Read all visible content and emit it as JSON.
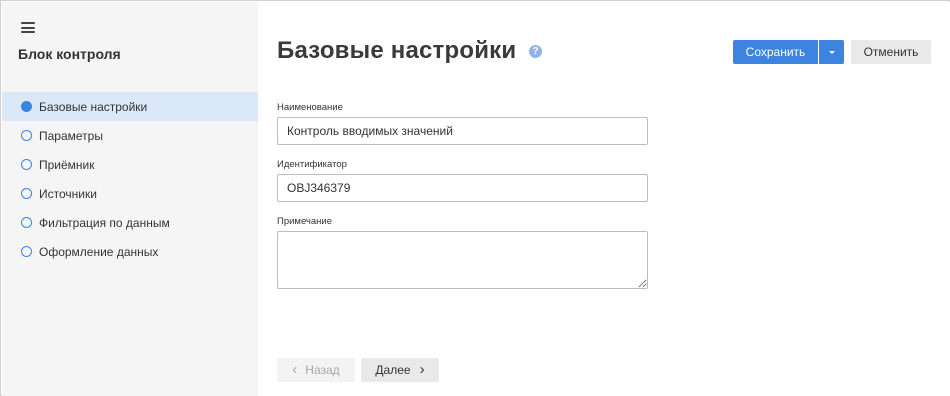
{
  "sidebar": {
    "menu_icon": "hamburger-menu-icon",
    "title": "Блок контроля",
    "items": [
      {
        "label": "Базовые настройки",
        "active": true
      },
      {
        "label": "Параметры",
        "active": false
      },
      {
        "label": "Приёмник",
        "active": false
      },
      {
        "label": "Источники",
        "active": false
      },
      {
        "label": "Фильтрация по данным",
        "active": false
      },
      {
        "label": "Оформление данных",
        "active": false
      }
    ]
  },
  "main": {
    "title": "Базовые настройки",
    "help_icon": "?",
    "save_label": "Сохранить",
    "cancel_label": "Отменить",
    "fields": {
      "name": {
        "label": "Наименование",
        "value": "Контроль вводимых значений"
      },
      "identifier": {
        "label": "Идентификатор",
        "value": "OBJ346379"
      },
      "note": {
        "label": "Примечание",
        "value": ""
      }
    },
    "back_label": "Назад",
    "next_label": "Далее",
    "back_chevron": "‹",
    "next_chevron": "›"
  },
  "colors": {
    "accent": "#3d84e0",
    "active_item_bg": "#dbe8f8",
    "sidebar_bg": "#f5f5f5"
  }
}
